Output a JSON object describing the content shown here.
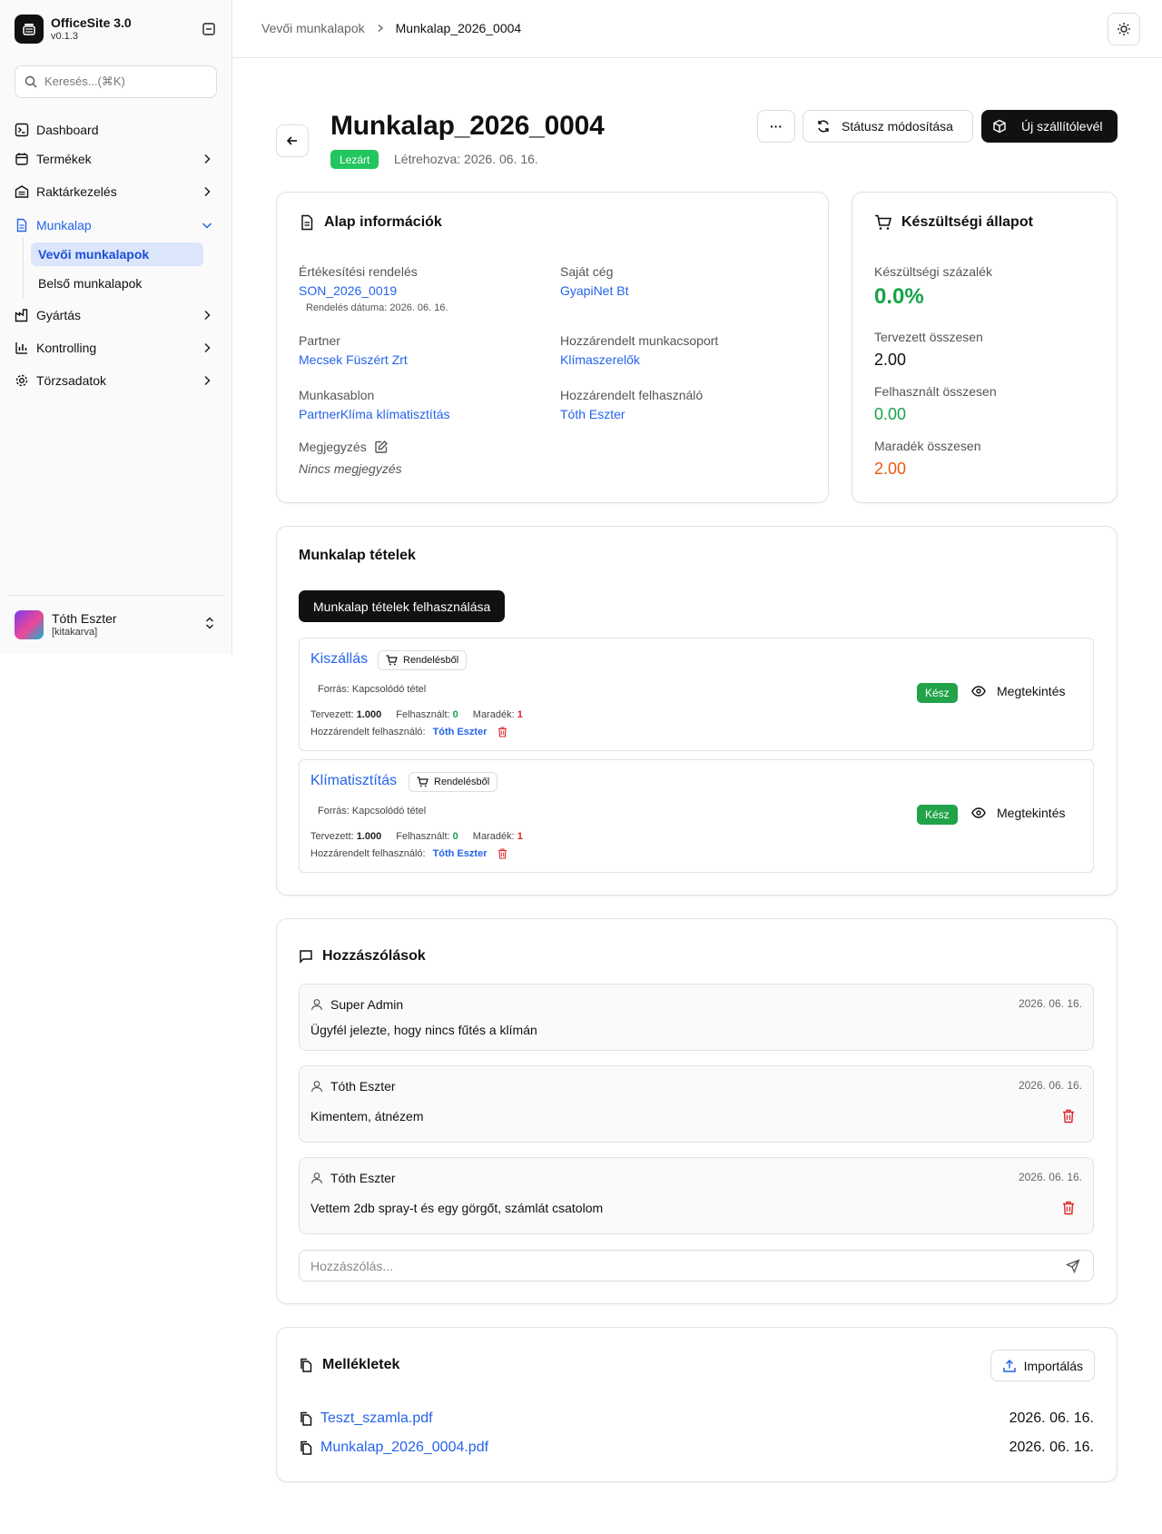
{
  "app": {
    "name": "OfficeSite 3.0",
    "version": "v0.1.3"
  },
  "search": {
    "placeholder": "Keresés...(⌘K)"
  },
  "nav": {
    "dashboard": "Dashboard",
    "products": "Termékek",
    "warehouse": "Raktárkezelés",
    "worksheet": "Munkalap",
    "customer_worksheets": "Vevői munkalapok",
    "internal_worksheets": "Belső munkalapok",
    "production": "Gyártás",
    "controlling": "Kontrolling",
    "master_data": "Törzsadatok"
  },
  "user": {
    "name": "Tóth Eszter",
    "role": "[kitakarva]"
  },
  "breadcrumb": {
    "parent": "Vevői munkalapok",
    "current": "Munkalap_2026_0004"
  },
  "page": {
    "title": "Munkalap_2026_0004",
    "status": "Lezárt",
    "created": "Létrehozva: 2026. 06. 16.",
    "more_label": "···",
    "status_change_label": "Státusz módosítása",
    "new_delivery_label": "Új szállítólevél"
  },
  "basic_info": {
    "title": "Alap információk",
    "sales_order_label": "Értékesítési rendelés",
    "sales_order_value": "SON_2026_0019",
    "order_date": "Rendelés dátuma: 2026. 06. 16.",
    "own_company_label": "Saját cég",
    "own_company_value": "GyapiNet Bt",
    "partner_label": "Partner",
    "partner_value": "Mecsek Füszért Zrt",
    "workgroup_label": "Hozzárendelt munkacsoport",
    "workgroup_value": "Klímaszerelők",
    "template_label": "Munkasablon",
    "template_value": "PartnerKlíma klímatisztítás",
    "assigned_user_label": "Hozzárendelt felhasználó",
    "assigned_user_value": "Tóth Eszter",
    "note_label": "Megjegyzés",
    "note_value": "Nincs megjegyzés"
  },
  "progress": {
    "title": "Készültségi állapot",
    "percent_label": "Készültségi százalék",
    "percent_value": "0.0%",
    "planned_label": "Tervezett összesen",
    "planned_value": "2.00",
    "used_label": "Felhasznált összesen",
    "used_value": "0.00",
    "remaining_label": "Maradék összesen",
    "remaining_value": "2.00",
    "colors": {
      "green": "#16a34a",
      "orange": "#ea580c"
    }
  },
  "items": {
    "title": "Munkalap tételek",
    "use_button": "Munkalap tételek felhasználása",
    "source_tag": "Rendelésből",
    "list": [
      {
        "name": "Kiszállás",
        "source": "Forrás: Kapcsolódó tétel",
        "planned_label": "Tervezett:",
        "planned": "1.000",
        "used_label": "Felhasznált:",
        "used": "0",
        "remaining_label": "Maradék:",
        "remaining": "1",
        "user_label": "Hozzárendelt felhasználó:",
        "user": "Tóth Eszter",
        "status": "Kész",
        "view": "Megtekintés"
      },
      {
        "name": "Klímatisztítás",
        "source": "Forrás: Kapcsolódó tétel",
        "planned_label": "Tervezett:",
        "planned": "1.000",
        "used_label": "Felhasznált:",
        "used": "0",
        "remaining_label": "Maradék:",
        "remaining": "1",
        "user_label": "Hozzárendelt felhasználó:",
        "user": "Tóth Eszter",
        "status": "Kész",
        "view": "Megtekintés"
      }
    ]
  },
  "comments": {
    "title": "Hozzászólások",
    "list": [
      {
        "author": "Super Admin",
        "date": "2026. 06. 16.",
        "text": "Ügyfél jelezte, hogy nincs fűtés a klímán"
      },
      {
        "author": "Tóth Eszter",
        "date": "2026. 06. 16.",
        "text": "Kimentem, átnézem"
      },
      {
        "author": "Tóth Eszter",
        "date": "2026. 06. 16.",
        "text": "Vettem 2db spray-t és egy görgőt, számlát csatolom"
      }
    ],
    "input_placeholder": "Hozzászólás..."
  },
  "attachments": {
    "title": "Mellékletek",
    "import_label": "Importálás",
    "list": [
      {
        "name": "Teszt_szamla.pdf",
        "date": "2026. 06. 16."
      },
      {
        "name": "Munkalap_2026_0004.pdf",
        "date": "2026. 06. 16."
      }
    ]
  }
}
